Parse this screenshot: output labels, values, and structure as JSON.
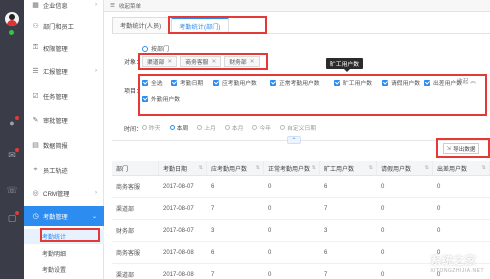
{
  "sidebar": {
    "items": [
      {
        "label": "企业信息",
        "icon": "building-icon"
      },
      {
        "label": "部门和员工",
        "icon": "org-icon"
      },
      {
        "label": "权限管理",
        "icon": "key-icon"
      },
      {
        "label": "汇报管理",
        "icon": "report-icon"
      },
      {
        "label": "任务管理",
        "icon": "task-icon"
      },
      {
        "label": "审批管理",
        "icon": "approval-icon"
      },
      {
        "label": "数据简报",
        "icon": "chart-icon"
      },
      {
        "label": "员工轨迹",
        "icon": "route-icon"
      },
      {
        "label": "CRM管理",
        "icon": "crm-icon"
      },
      {
        "label": "考勤管理",
        "icon": "clock-icon"
      }
    ],
    "sub_items": [
      "考勤统计",
      "考勤明细",
      "考勤设置"
    ]
  },
  "topbar": {
    "label": "收起菜单"
  },
  "tabs": [
    "考勤统计(人员)",
    "考勤统计(部门)"
  ],
  "filters": {
    "object_label": "对象：",
    "radio_label": "按部门",
    "tags": [
      "渠道部",
      "商务客服",
      "财务部"
    ],
    "items_label": "项目：",
    "checks": [
      "全选",
      "考勤日期",
      "应考勤用户数",
      "正常考勤用户数",
      "旷工用户数",
      "请假用户数",
      "出差用户数",
      "外勤用户数"
    ],
    "collapse": "收起 ︽",
    "tooltip": "旷工用户数",
    "time_label": "时间：",
    "time_options": [
      "昨天",
      "本周",
      "上月",
      "本月",
      "今年",
      "自定义日期"
    ]
  },
  "export_label": "导出数据",
  "table": {
    "headers": [
      "部门",
      "考勤日期",
      "应考勤用户数",
      "正常考勤用户数",
      "旷工用户数",
      "请假用户数",
      "出差用户数"
    ],
    "rows": [
      [
        "商务客服",
        "2017-08-07",
        "6",
        "0",
        "6",
        "0",
        "0"
      ],
      [
        "渠道部",
        "2017-08-07",
        "7",
        "0",
        "7",
        "0",
        "0"
      ],
      [
        "财务部",
        "2017-08-07",
        "3",
        "0",
        "3",
        "0",
        "0"
      ],
      [
        "商务客服",
        "2017-08-08",
        "6",
        "0",
        "6",
        "0",
        "0"
      ],
      [
        "渠道部",
        "2017-08-08",
        "7",
        "0",
        "7",
        "0",
        "0"
      ]
    ]
  },
  "watermark": {
    "main": "系统之家",
    "sub": "XITONGZHIJIA.NET"
  },
  "colors": {
    "accent": "#2d8cf0",
    "highlight": "#e53935",
    "rail": "#3a3d47"
  }
}
